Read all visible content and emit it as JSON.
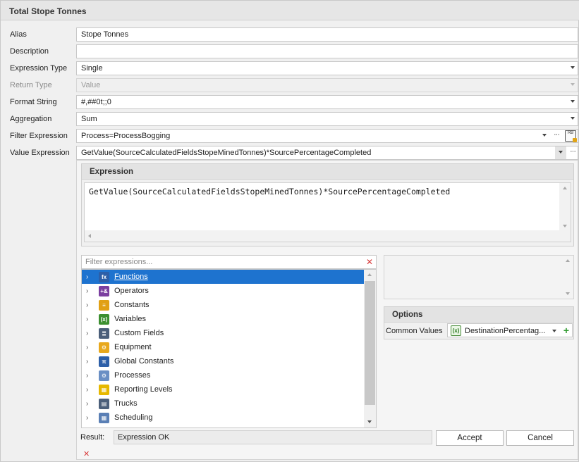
{
  "window": {
    "title": "Total Stope Tonnes"
  },
  "form": {
    "alias": {
      "label": "Alias",
      "value": "Stope Tonnes"
    },
    "description": {
      "label": "Description",
      "value": ""
    },
    "expression_type": {
      "label": "Expression Type",
      "value": "Single"
    },
    "return_type": {
      "label": "Return Type",
      "value": "Value"
    },
    "format_string": {
      "label": "Format String",
      "value": "#,##0t;;0"
    },
    "aggregation": {
      "label": "Aggregation",
      "value": "Sum"
    },
    "filter_expression": {
      "label": "Filter Expression",
      "value": "Process=ProcessBogging",
      "ellipsis": "···",
      "icon_text": "RB"
    },
    "value_expression": {
      "label": "Value Expression",
      "value": "GetValue(SourceCalculatedFieldsStopeMinedTonnes)*SourcePercentageCompleted",
      "ellipsis": "···"
    }
  },
  "expression_panel": {
    "header": "Expression",
    "text": "GetValue(SourceCalculatedFieldsStopeMinedTonnes)*SourcePercentageCompleted"
  },
  "filter": {
    "placeholder": "Filter expressions...",
    "clear_glyph": "✕"
  },
  "tree": {
    "items": [
      {
        "label": "Functions",
        "icon": "function-icon",
        "color": "#2d5fa8",
        "glyph": "fx",
        "selected": true
      },
      {
        "label": "Operators",
        "icon": "operators-icon",
        "color": "#7b3fa0",
        "glyph": "+&"
      },
      {
        "label": "Constants",
        "icon": "constants-icon",
        "color": "#e1a014",
        "glyph": "≡"
      },
      {
        "label": "Variables",
        "icon": "variables-icon",
        "color": "#3c8f2f",
        "glyph": "(x)"
      },
      {
        "label": "Custom Fields",
        "icon": "custom-fields-icon",
        "color": "#4b5f7a",
        "glyph": "≣"
      },
      {
        "label": "Equipment",
        "icon": "equipment-icon",
        "color": "#e8a81c",
        "glyph": "⚙"
      },
      {
        "label": "Global Constants",
        "icon": "pi-icon",
        "color": "#2d5fa8",
        "glyph": "π"
      },
      {
        "label": "Processes",
        "icon": "processes-icon",
        "color": "#6a8fc4",
        "glyph": "⚙"
      },
      {
        "label": "Reporting Levels",
        "icon": "reporting-levels-icon",
        "color": "#e6b800",
        "glyph": "▦"
      },
      {
        "label": "Trucks",
        "icon": "trucks-icon",
        "color": "#4b5f7a",
        "glyph": "▤"
      },
      {
        "label": "Scheduling",
        "icon": "scheduling-icon",
        "color": "#5a7fb5",
        "glyph": "▦"
      }
    ]
  },
  "options": {
    "header": "Options",
    "common_values_label": "Common Values",
    "common_values_value": "DestinationPercentag...",
    "common_values_icon_glyph": "(x)",
    "add_glyph": "+"
  },
  "result": {
    "label": "Result:",
    "value": "Expression OK",
    "status_glyph": "✕"
  },
  "buttons": {
    "accept": "Accept",
    "cancel": "Cancel"
  },
  "colors": {
    "selection": "#1e73cf",
    "error": "#d83a3a",
    "add": "#2f9b2f"
  }
}
